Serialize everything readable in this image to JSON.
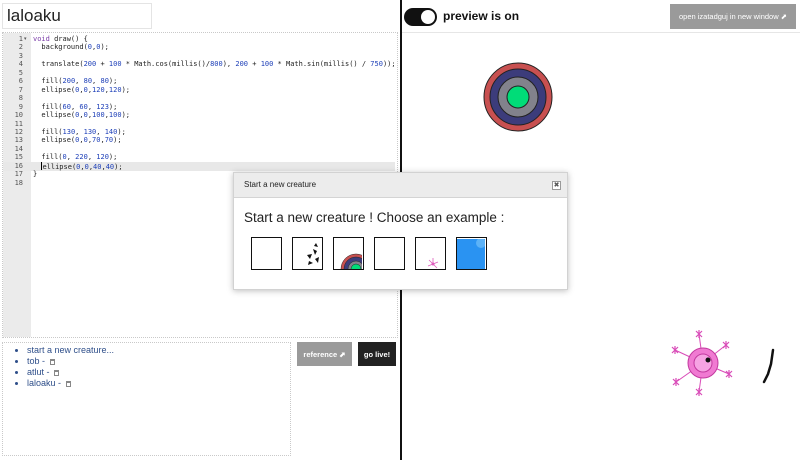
{
  "editor": {
    "creature_name": "laloaku",
    "lines": [
      {
        "n": "1",
        "fold": true,
        "code": "<span class=\"kw\">void</span> draw() {"
      },
      {
        "n": "2",
        "code": "  background(<span class=\"num\">0</span>,<span class=\"num\">0</span>);"
      },
      {
        "n": "3",
        "code": ""
      },
      {
        "n": "4",
        "code": "  translate(<span class=\"num\">200</span> + <span class=\"num\">100</span> * Math.cos(millis()/<span class=\"num\">800</span>), <span class=\"num\">200</span> + <span class=\"num\">100</span> * Math.sin(millis() / <span class=\"num\">750</span>));"
      },
      {
        "n": "5",
        "code": ""
      },
      {
        "n": "6",
        "code": "  fill(<span class=\"num\">200</span>, <span class=\"num\">80</span>, <span class=\"num\">80</span>);"
      },
      {
        "n": "7",
        "code": "  ellipse(<span class=\"num\">0</span>,<span class=\"num\">0</span>,<span class=\"num\">120</span>,<span class=\"num\">120</span>);"
      },
      {
        "n": "8",
        "code": ""
      },
      {
        "n": "9",
        "code": "  fill(<span class=\"num\">60</span>, <span class=\"num\">60</span>, <span class=\"num\">123</span>);"
      },
      {
        "n": "10",
        "code": "  ellipse(<span class=\"num\">0</span>,<span class=\"num\">0</span>,<span class=\"num\">100</span>,<span class=\"num\">100</span>);"
      },
      {
        "n": "11",
        "code": ""
      },
      {
        "n": "12",
        "code": "  fill(<span class=\"num\">130</span>, <span class=\"num\">130</span>, <span class=\"num\">140</span>);"
      },
      {
        "n": "13",
        "code": "  ellipse(<span class=\"num\">0</span>,<span class=\"num\">0</span>,<span class=\"num\">70</span>,<span class=\"num\">70</span>);"
      },
      {
        "n": "14",
        "code": ""
      },
      {
        "n": "15",
        "code": "  fill(<span class=\"num\">0</span>, <span class=\"num\">220</span>, <span class=\"num\">120</span>);"
      },
      {
        "n": "16",
        "active": true,
        "code": "  <span class=\"cursor\"></span>ellipse(<span class=\"num\">0</span>,<span class=\"num\">0</span>,<span class=\"num\">40</span>,<span class=\"num\">40</span>);"
      },
      {
        "n": "17",
        "code": "}"
      },
      {
        "n": "18",
        "code": ""
      }
    ]
  },
  "creature_list": [
    {
      "label": "start a new creature...",
      "trash": false
    },
    {
      "label": "tob - ",
      "trash": true
    },
    {
      "label": "atlut - ",
      "trash": true
    },
    {
      "label": "laloaku - ",
      "trash": true
    }
  ],
  "buttons": {
    "reference": "reference ⬈",
    "go_live": "go live!"
  },
  "preview": {
    "label": "preview is on",
    "on": true,
    "open_window": "open izatadguj in new window ⬈"
  },
  "modal": {
    "title": "Start a new creature",
    "close": "✖",
    "prompt": "Start a new creature ! Choose an example :",
    "examples": [
      {
        "name": "blank"
      },
      {
        "name": "shapes"
      },
      {
        "name": "rings"
      },
      {
        "name": "blank"
      },
      {
        "name": "star"
      },
      {
        "name": "blue"
      }
    ]
  },
  "colors": {
    "red": "#c85050",
    "navy": "#3c3c7b",
    "gray": "#82828c",
    "green": "#00dc78",
    "pink": "#f07ad2",
    "blue": "#2a93f2"
  }
}
